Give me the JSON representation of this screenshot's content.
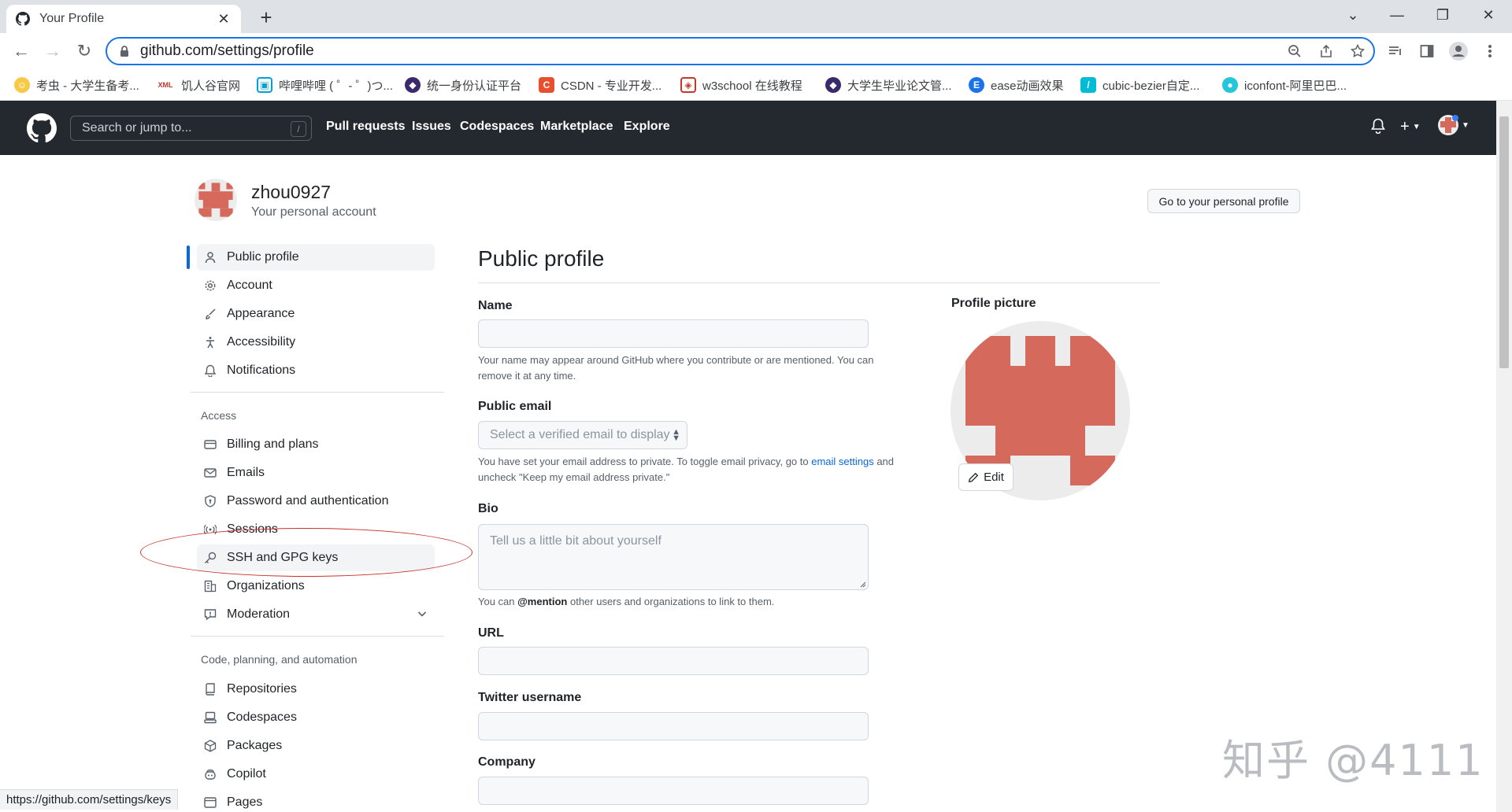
{
  "browser": {
    "tab_title": "Your Profile",
    "url": "github.com/settings/profile",
    "bookmarks": [
      "考虫 - 大学生备考...",
      "饥人谷官网",
      "哔哩哔哩 ( ゜- ゜)つ...",
      "统一身份认证平台",
      "CSDN - 专业开发...",
      "w3school 在线教程",
      "大学生毕业论文管...",
      "ease动画效果",
      "cubic-bezier自定...",
      "iconfont-阿里巴巴..."
    ],
    "bookmark_badge": "XML",
    "status_url": "https://github.com/settings/keys"
  },
  "github_header": {
    "search_placeholder": "Search or jump to...",
    "search_shortcut": "/",
    "nav": [
      "Pull requests",
      "Issues",
      "Codespaces",
      "Marketplace",
      "Explore"
    ]
  },
  "account": {
    "username": "zhou0927",
    "subtitle": "Your personal account",
    "go_profile_button": "Go to your personal profile"
  },
  "sidebar": {
    "items": [
      {
        "label": "Public profile",
        "icon": "person-icon"
      },
      {
        "label": "Account",
        "icon": "gear-icon"
      },
      {
        "label": "Appearance",
        "icon": "paintbrush-icon"
      },
      {
        "label": "Accessibility",
        "icon": "accessibility-icon"
      },
      {
        "label": "Notifications",
        "icon": "bell-icon"
      }
    ],
    "access_heading": "Access",
    "access_items": [
      {
        "label": "Billing and plans",
        "icon": "credit-card-icon"
      },
      {
        "label": "Emails",
        "icon": "mail-icon"
      },
      {
        "label": "Password and authentication",
        "icon": "shield-lock-icon"
      },
      {
        "label": "Sessions",
        "icon": "broadcast-icon"
      },
      {
        "label": "SSH and GPG keys",
        "icon": "key-icon"
      },
      {
        "label": "Organizations",
        "icon": "organization-icon"
      },
      {
        "label": "Moderation",
        "icon": "report-icon"
      }
    ],
    "code_heading": "Code, planning, and automation",
    "code_items": [
      {
        "label": "Repositories",
        "icon": "repo-icon"
      },
      {
        "label": "Codespaces",
        "icon": "codespaces-icon"
      },
      {
        "label": "Packages",
        "icon": "package-icon"
      },
      {
        "label": "Copilot",
        "icon": "copilot-icon"
      },
      {
        "label": "Pages",
        "icon": "browser-icon"
      }
    ]
  },
  "profile_form": {
    "heading": "Public profile",
    "name_label": "Name",
    "name_note": "Your name may appear around GitHub where you contribute or are mentioned. You can remove it at any time.",
    "email_label": "Public email",
    "email_select": "Select a verified email to display",
    "email_note_pre": "You have set your email address to private. To toggle email privacy, go to ",
    "email_note_link": "email settings",
    "email_note_post": " and uncheck \"Keep my email address private.\"",
    "bio_label": "Bio",
    "bio_placeholder": "Tell us a little bit about yourself",
    "bio_note_pre": "You can ",
    "bio_note_mention": "@mention",
    "bio_note_post": " other users and organizations to link to them.",
    "url_label": "URL",
    "twitter_label": "Twitter username",
    "company_label": "Company",
    "picture_label": "Profile picture",
    "edit_button": "Edit"
  },
  "watermark": "知乎 @4111",
  "colors": {
    "identicon": "#d56a5c",
    "header_bg": "#24292f",
    "link": "#0969da",
    "annotation": "#c9302c"
  }
}
